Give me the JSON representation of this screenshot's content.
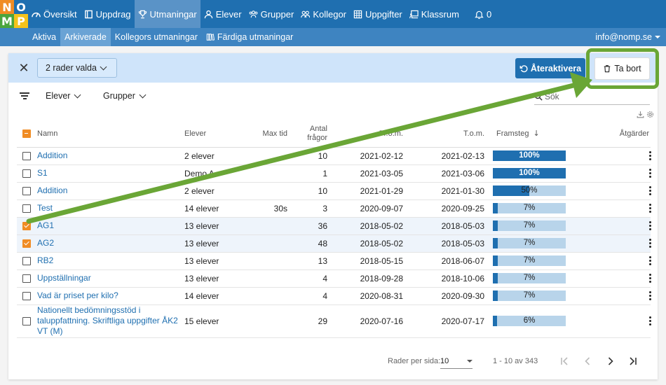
{
  "logo": {
    "letters": [
      "N",
      "O",
      "M",
      "P"
    ],
    "colors": [
      "#f08c24",
      "#1f6fb0",
      "#4aa53d",
      "#f4c31c"
    ]
  },
  "nav": {
    "items": [
      {
        "label": "Översikt",
        "icon": "speedometer-icon"
      },
      {
        "label": "Uppdrag",
        "icon": "book-icon"
      },
      {
        "label": "Utmaningar",
        "icon": "trophy-icon",
        "active": true
      },
      {
        "label": "Elever",
        "icon": "user-icon"
      },
      {
        "label": "Grupper",
        "icon": "users-icon"
      },
      {
        "label": "Kollegor",
        "icon": "user-group-icon"
      },
      {
        "label": "Uppgifter",
        "icon": "grid-icon"
      },
      {
        "label": "Klassrum",
        "icon": "chalkboard-icon"
      }
    ],
    "notifications": "0"
  },
  "subnav": {
    "items": [
      {
        "label": "Aktiva"
      },
      {
        "label": "Arkiverade",
        "active": true
      },
      {
        "label": "Kollegors utmaningar"
      },
      {
        "label": "Färdiga utmaningar"
      }
    ],
    "user_email": "info@nomp.se"
  },
  "selection": {
    "label": "2 rader valda",
    "reactivate_label": "Återaktivera",
    "delete_label": "Ta bort"
  },
  "filters": {
    "students_label": "Elever",
    "groups_label": "Grupper",
    "search_placeholder": "Sök"
  },
  "table": {
    "headers": {
      "name": "Namn",
      "students": "Elever",
      "max_time": "Max tid",
      "questions": "Antal frågor",
      "from": "Fr.o.m.",
      "to": "T.o.m.",
      "progress": "Framsteg",
      "actions": "Åtgärder"
    },
    "rows": [
      {
        "name": "Addition",
        "students": "2 elever",
        "max_time": "",
        "questions": "10",
        "from": "2021-02-12",
        "to": "2021-02-13",
        "progress": 100,
        "progress_label": "100%",
        "selected": false
      },
      {
        "name": "S1",
        "students": "Demo A",
        "max_time": "",
        "questions": "1",
        "from": "2021-03-05",
        "to": "2021-03-06",
        "progress": 100,
        "progress_label": "100%",
        "selected": false
      },
      {
        "name": "Addition",
        "students": "2 elever",
        "max_time": "",
        "questions": "10",
        "from": "2021-01-29",
        "to": "2021-01-30",
        "progress": 50,
        "progress_label": "50%",
        "selected": false
      },
      {
        "name": "Test",
        "students": "14 elever",
        "max_time": "30s",
        "questions": "3",
        "from": "2020-09-07",
        "to": "2020-09-25",
        "progress": 7,
        "progress_label": "7%",
        "selected": false
      },
      {
        "name": "AG1",
        "students": "13 elever",
        "max_time": "",
        "questions": "36",
        "from": "2018-05-02",
        "to": "2018-05-03",
        "progress": 7,
        "progress_label": "7%",
        "selected": true
      },
      {
        "name": "AG2",
        "students": "13 elever",
        "max_time": "",
        "questions": "48",
        "from": "2018-05-02",
        "to": "2018-05-03",
        "progress": 7,
        "progress_label": "7%",
        "selected": true
      },
      {
        "name": "RB2",
        "students": "13 elever",
        "max_time": "",
        "questions": "13",
        "from": "2018-05-15",
        "to": "2018-06-07",
        "progress": 7,
        "progress_label": "7%",
        "selected": false
      },
      {
        "name": "Uppställningar",
        "students": "13 elever",
        "max_time": "",
        "questions": "4",
        "from": "2018-09-28",
        "to": "2018-10-06",
        "progress": 7,
        "progress_label": "7%",
        "selected": false
      },
      {
        "name": "Vad är priset per kilo?",
        "students": "14 elever",
        "max_time": "",
        "questions": "4",
        "from": "2020-08-31",
        "to": "2020-09-30",
        "progress": 7,
        "progress_label": "7%",
        "selected": false
      },
      {
        "name": "Nationellt bedömningsstöd i taluppfattning. Skriftliga uppgifter ÅK2 VT (M)",
        "students": "15 elever",
        "max_time": "",
        "questions": "29",
        "from": "2020-07-16",
        "to": "2020-07-17",
        "progress": 6,
        "progress_label": "6%",
        "selected": false
      }
    ]
  },
  "pagination": {
    "rows_per_page_label": "Rader per sida:",
    "rows_per_page": "10",
    "range": "1 - 10 av 343"
  },
  "colors": {
    "primary": "#1f6fb0",
    "subnav": "#3e84c1",
    "selection_bar": "#cfe4fa",
    "checkbox": "#f08c24",
    "annotation": "#6aa636",
    "progress_track": "#b8d4ea"
  }
}
